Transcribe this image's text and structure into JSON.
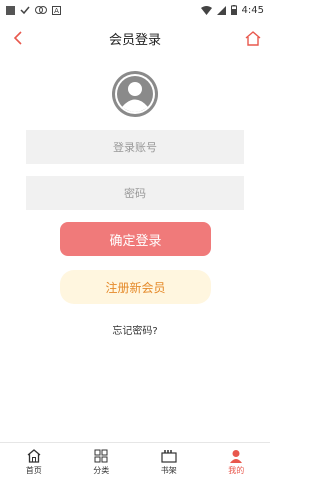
{
  "status_bar": {
    "time": "4:45",
    "icons": [
      "notification-square-icon",
      "check-icon",
      "cast-icon",
      "app-icon",
      "wifi-icon",
      "signal-icon",
      "battery-icon"
    ]
  },
  "header": {
    "title": "会员登录",
    "back_icon": "chevron-left-icon",
    "home_icon": "home-icon"
  },
  "form": {
    "account_placeholder": "登录账号",
    "password_placeholder": "密码",
    "login_label": "确定登录",
    "register_label": "注册新会员",
    "forgot_label": "忘记密码?"
  },
  "tabbar": {
    "items": [
      {
        "label": "首页",
        "icon": "home-icon"
      },
      {
        "label": "分类",
        "icon": "grid-icon"
      },
      {
        "label": "书架",
        "icon": "bookshelf-icon"
      },
      {
        "label": "我的",
        "icon": "user-icon",
        "active": true
      }
    ]
  },
  "colors": {
    "accent": "#e8584d",
    "login_button": "#f07a7a",
    "register_bg": "#fff6df",
    "register_text": "#e58a2a",
    "input_bg": "#f1f1f1"
  }
}
